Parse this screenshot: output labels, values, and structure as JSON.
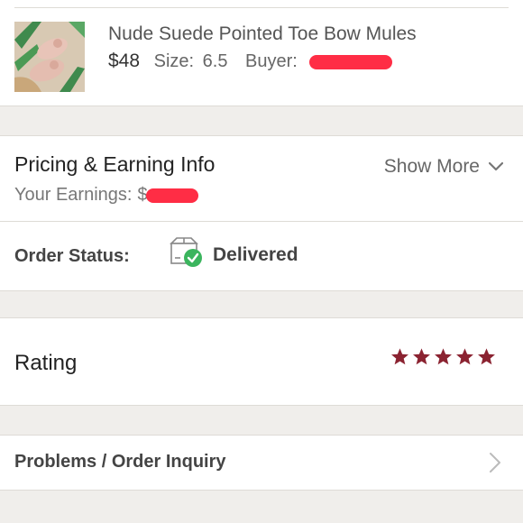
{
  "listing": {
    "title": "Nude Suede Pointed Toe Bow Mules",
    "price": "$48",
    "size_label": "Size:",
    "size_value": "6.5",
    "buyer_label": "Buyer:"
  },
  "pricing": {
    "title": "Pricing & Earning Info",
    "show_more": "Show More",
    "earnings_label": "Your Earnings:",
    "earnings_prefix": "$"
  },
  "order_status": {
    "label": "Order Status:",
    "value": "Delivered"
  },
  "rating": {
    "title": "Rating",
    "stars": 5
  },
  "problems": {
    "label": "Problems / Order Inquiry"
  },
  "colors": {
    "star": "#8b2331",
    "check_green": "#3bb55e",
    "redaction": "#ff2d45"
  }
}
